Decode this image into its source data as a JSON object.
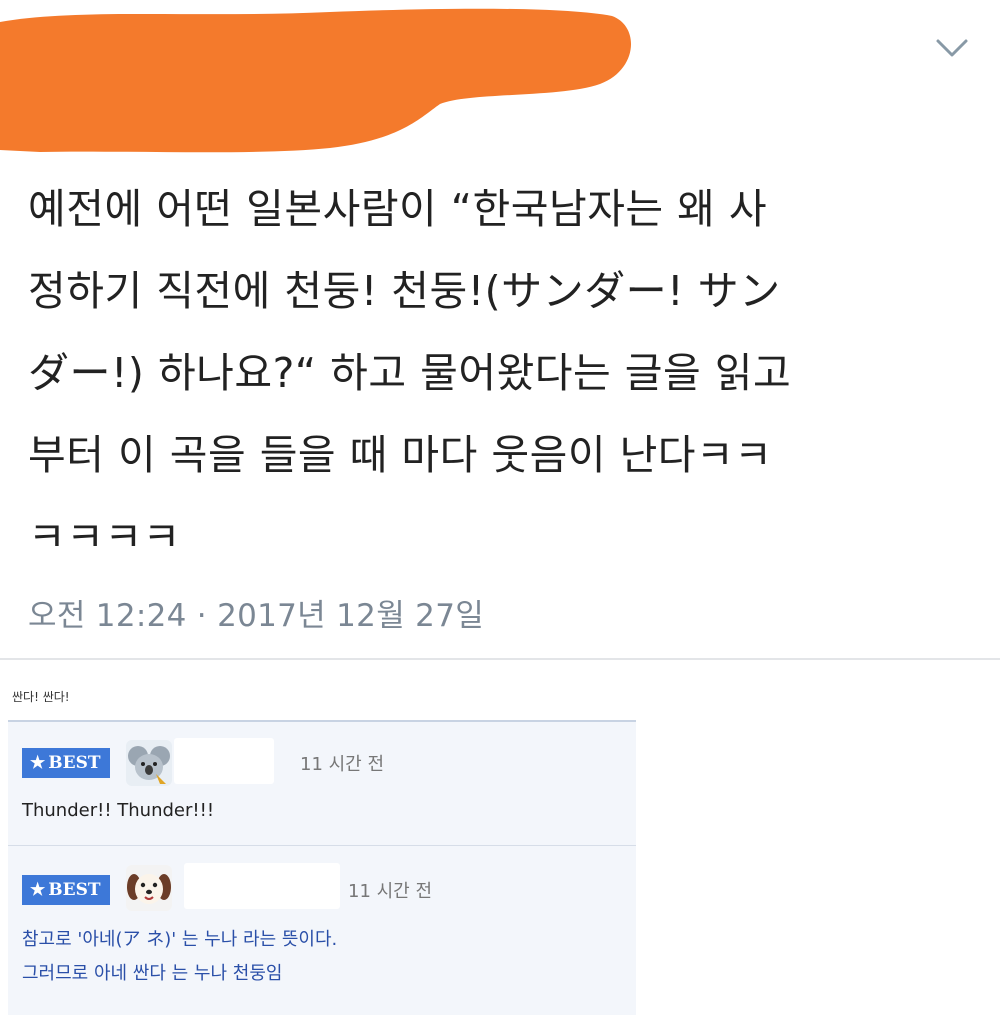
{
  "tweet": {
    "lines": [
      "예전에 어떤 일본사람이 “한국남자는 왜 사",
      "정하기 직전에 천둥! 천둥!(サンダー! サン",
      "ダー!) 하나요?“ 하고 물어왔다는 글을 읽고",
      "부터 이 곡을 들을 때 마다 웃음이 난다ㅋㅋ",
      "ㅋㅋㅋㅋ"
    ],
    "timestamp": "오전 12:24 · 2017년 12월 27일",
    "redaction_color": "#f47a2c"
  },
  "comments": {
    "caption": "싼다! 싼다!",
    "items": [
      {
        "badge": "BEST",
        "time": "11 시간 전",
        "lines": [
          "Thunder!! Thunder!!!"
        ]
      },
      {
        "badge": "BEST",
        "time": "11 시간 전",
        "lines": [
          "참고로 '아네(ア ネ)' 는 누나 라는 뜻이다.",
          "그러므로 아네 싼다 는 누나 천둥임"
        ]
      }
    ]
  }
}
